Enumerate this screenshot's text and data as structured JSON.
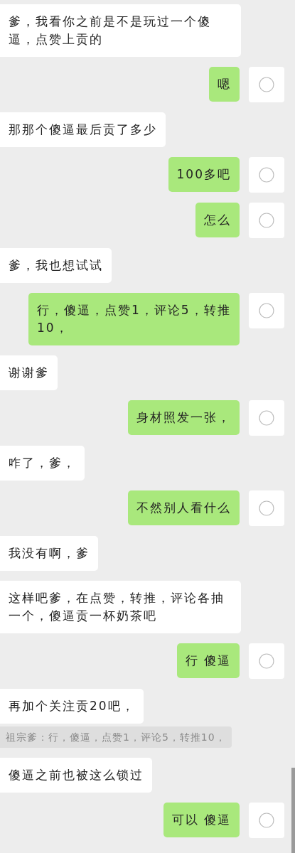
{
  "messages": [
    {
      "kind": "received",
      "text": "爹，我看你之前是不是玩过一个傻逼，点赞上贡的"
    },
    {
      "kind": "sent",
      "text": "嗯"
    },
    {
      "kind": "received",
      "text": "那那个傻逼最后贡了多少"
    },
    {
      "kind": "sent",
      "text": "100多吧"
    },
    {
      "kind": "sent",
      "text": "怎么"
    },
    {
      "kind": "received",
      "text": "爹，我也想试试"
    },
    {
      "kind": "sent",
      "text": "行，傻逼，点赞1，评论5，转推10，"
    },
    {
      "kind": "received",
      "text": "谢谢爹"
    },
    {
      "kind": "sent",
      "text": "身材照发一张，"
    },
    {
      "kind": "received",
      "text": "咋了，爹，"
    },
    {
      "kind": "sent",
      "text": "不然别人看什么"
    },
    {
      "kind": "received",
      "text": "我没有啊，爹"
    },
    {
      "kind": "received",
      "text": "这样吧爹，在点赞，转推，评论各抽一个，傻逼贡一杯奶茶吧"
    },
    {
      "kind": "sent",
      "text": "行 傻逼"
    },
    {
      "kind": "received",
      "text": "再加个关注贡20吧，",
      "quote": "祖宗爹：行，傻逼，点赞1，评论5，转推10，"
    },
    {
      "kind": "received",
      "text": "傻逼之前也被这么锁过"
    },
    {
      "kind": "sent",
      "text": "可以 傻逼"
    }
  ]
}
